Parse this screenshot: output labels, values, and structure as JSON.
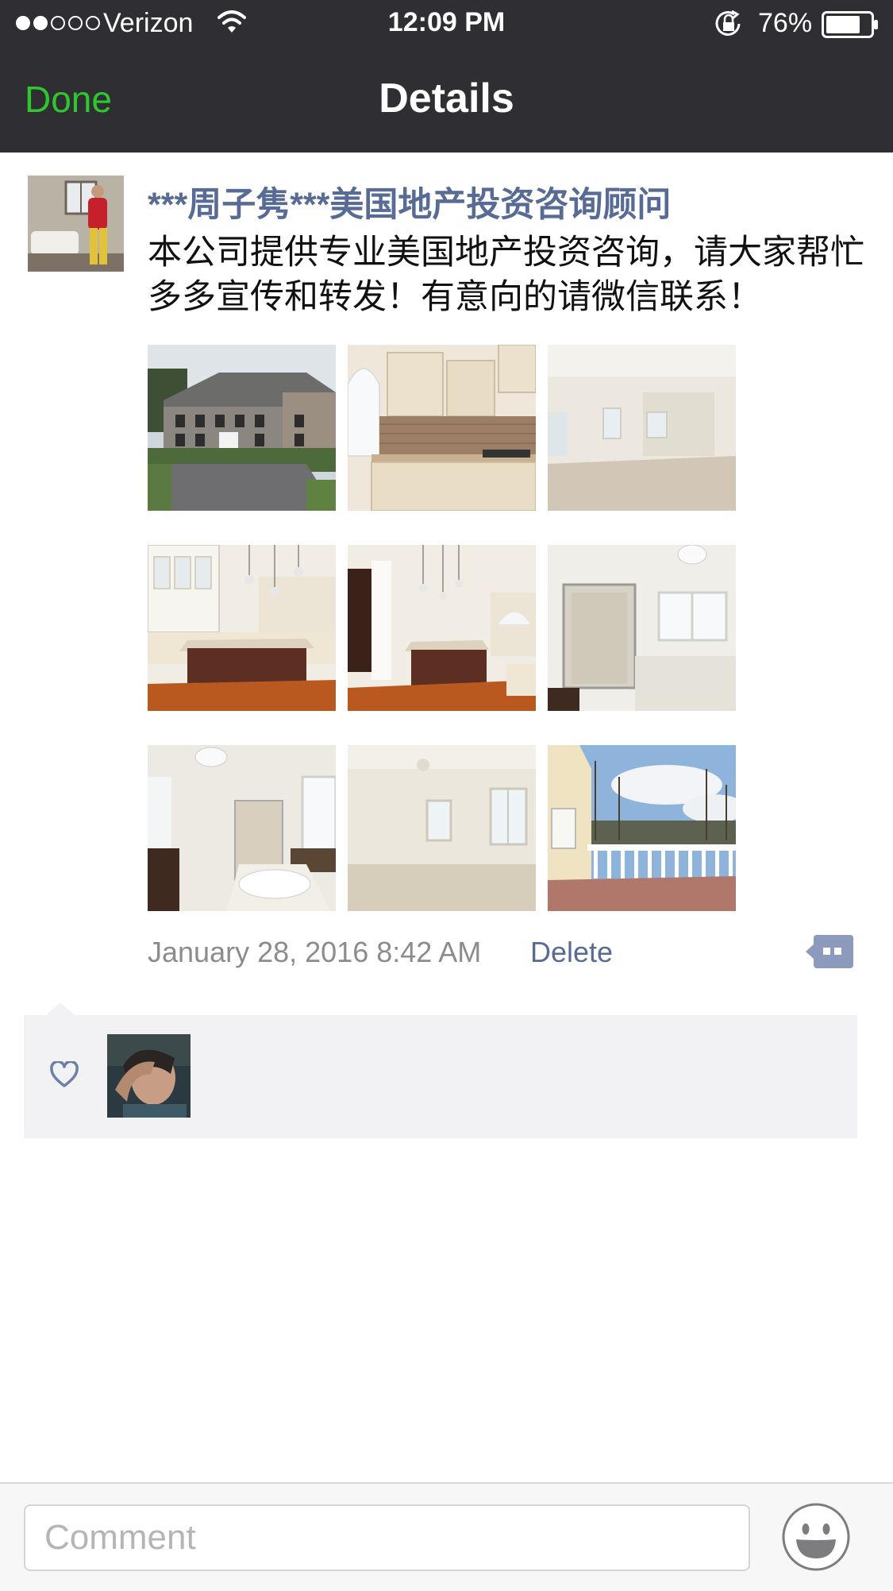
{
  "status_bar": {
    "carrier": "Verizon",
    "time": "12:09 PM",
    "battery": "76%",
    "signal_bars_filled": 2,
    "signal_bars_total": 5,
    "battery_level": 0.76
  },
  "nav": {
    "done_label": "Done",
    "title": "Details"
  },
  "post": {
    "author": "***周子隽***美国地产投资咨询顾问",
    "text": "本公司提供专业美国地产投资咨询，请大家帮忙多多宣传和转发！有意向的请微信联系！",
    "photos": [
      "exterior-house-photo",
      "kitchen-cabinets-photo",
      "empty-room-photo",
      "kitchen-island-photo",
      "kitchen-island-photo-2",
      "bathroom-shower-photo",
      "master-bath-photo",
      "bedroom-photo",
      "deck-photo"
    ],
    "timestamp": "January 28, 2016 8:42 AM",
    "delete_label": "Delete"
  },
  "likes": {
    "icon": "heart-icon"
  },
  "comment_bar": {
    "placeholder": "Comment",
    "emoji_icon": "smiley-icon"
  },
  "colors": {
    "bar_background": "#2f2f33",
    "done_green": "#2ec72e",
    "link_blue": "#576b95",
    "panel_gray": "#f2f2f4"
  }
}
